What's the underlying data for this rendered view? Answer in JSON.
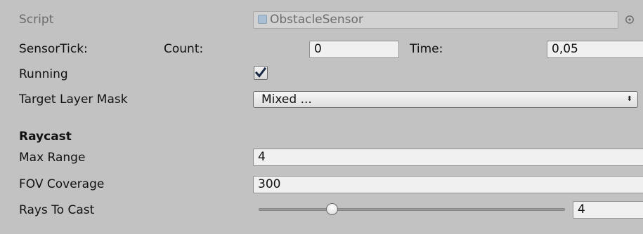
{
  "script_row": {
    "label": "Script",
    "value": "ObstacleSensor",
    "icon": "script-file-icon",
    "picker_icon": "object-picker-icon"
  },
  "sensor_tick": {
    "label": "SensorTick:",
    "count_label": "Count:",
    "count_value": "0",
    "time_label": "Time:",
    "time_value": "0,05"
  },
  "running": {
    "label": "Running",
    "checked": true
  },
  "target_layer_mask": {
    "label": "Target Layer Mask",
    "value": "Mixed ...",
    "arrow_icon": "dropdown-arrows-icon"
  },
  "raycast": {
    "header": "Raycast",
    "max_range": {
      "label": "Max Range",
      "value": "4"
    },
    "fov_coverage": {
      "label": "FOV Coverage",
      "value": "300"
    },
    "rays_to_cast": {
      "label": "Rays To Cast",
      "value": "4",
      "slider_fraction": 0.24
    }
  },
  "colors": {
    "background": "#c2c2c2",
    "field": "#f0f0f0",
    "disabled_field": "#d2d2d2",
    "checkmark": "#1a2a44"
  }
}
